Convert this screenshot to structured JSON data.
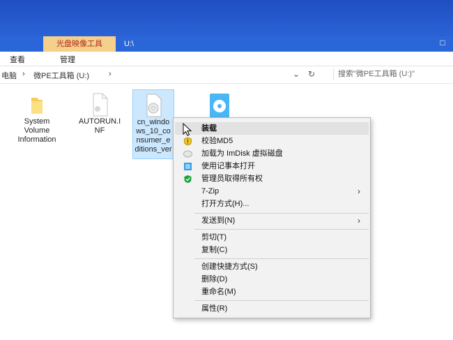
{
  "window": {
    "context_tab": "光盘映像工具",
    "path_tab": "U:\\",
    "restore_glyph": "□"
  },
  "ribbon": {
    "tabs": [
      "查看",
      "管理"
    ]
  },
  "address": {
    "crumbs": [
      "电脑",
      "›",
      "微PE工具箱 (U:)",
      "›"
    ],
    "dropdown_glyph": "⌄",
    "refresh_glyph": "↻",
    "search_placeholder": "搜索\"微PE工具箱 (U:)\""
  },
  "files": [
    {
      "name": "System Volume Information",
      "icon": "folder-icon"
    },
    {
      "name": "AUTORUN.INF",
      "icon": "file-icon"
    },
    {
      "name": "cn_windows_10_consumer_editions_ver...",
      "icon": "disc-image-icon"
    },
    {
      "name": "",
      "icon": "disc-image-icon"
    }
  ],
  "context_menu": {
    "items": [
      {
        "label": "装载",
        "bold": true,
        "icon": ""
      },
      {
        "label": "校验MD5",
        "icon": "shield-icon"
      },
      {
        "label": "加载为 ImDisk 虚拟磁盘",
        "icon": "disk-icon"
      },
      {
        "label": "使用记事本打开",
        "icon": "notepad-icon"
      },
      {
        "label": "管理员取得所有权",
        "icon": "green-shield-icon"
      },
      {
        "label": "7-Zip",
        "submenu": true,
        "icon": ""
      },
      {
        "label": "打开方式(H)...",
        "icon": ""
      },
      {
        "label": "发送到(N)",
        "submenu": true,
        "icon": ""
      },
      {
        "label": "剪切(T)",
        "icon": ""
      },
      {
        "label": "复制(C)",
        "icon": ""
      },
      {
        "label": "创建快捷方式(S)",
        "icon": ""
      },
      {
        "label": "删除(D)",
        "icon": ""
      },
      {
        "label": "重命名(M)",
        "icon": ""
      },
      {
        "label": "属性(R)",
        "icon": ""
      }
    ],
    "submenu_glyph": "›"
  },
  "colors": {
    "titlebar": "#2a63d6",
    "context_tab_bg": "#f4d08b",
    "selection": "#cce8ff"
  }
}
